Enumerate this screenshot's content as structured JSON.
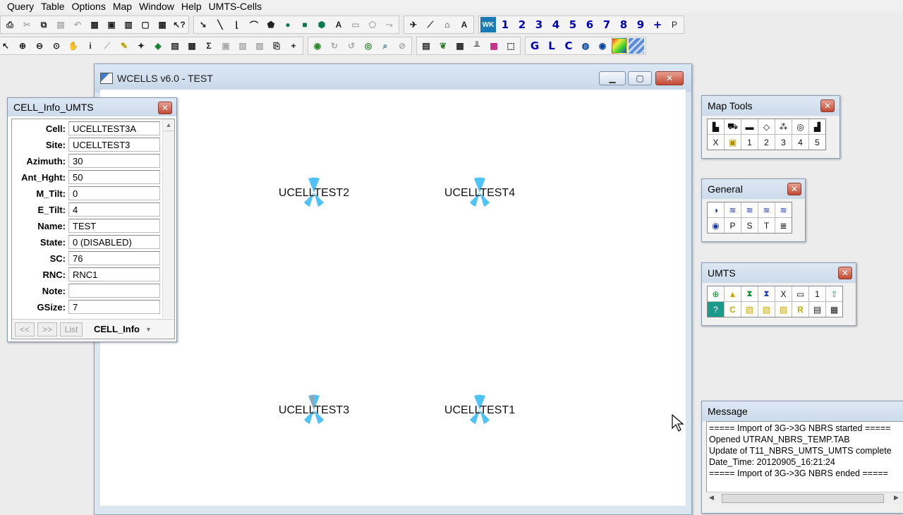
{
  "menu": [
    "Query",
    "Table",
    "Options",
    "Map",
    "Window",
    "Help",
    "UMTS-Cells"
  ],
  "toolbar": {
    "numbers": [
      "1",
      "2",
      "3",
      "4",
      "5",
      "6",
      "7",
      "8",
      "9"
    ],
    "plus": "+",
    "p": "P",
    "letters": [
      "G",
      "L",
      "C"
    ],
    "sigma": "Σ",
    "info": "i",
    "text": "A"
  },
  "main_window": {
    "title": "WCELLS v6.0 - TEST"
  },
  "map": {
    "cells": [
      {
        "name": "UCELLTEST2"
      },
      {
        "name": "UCELLTEST4"
      },
      {
        "name": "UCELLTEST3"
      },
      {
        "name": "UCELLTEST1"
      }
    ],
    "antenna_color": "#4fc3f7"
  },
  "cell_info": {
    "title": "CELL_Info_UMTS",
    "fields": [
      {
        "label": "Cell:",
        "value": "UCELLTEST3A"
      },
      {
        "label": "Site:",
        "value": "UCELLTEST3"
      },
      {
        "label": "Azimuth:",
        "value": "30"
      },
      {
        "label": "Ant_Hght:",
        "value": "50"
      },
      {
        "label": "M_Tilt:",
        "value": "0"
      },
      {
        "label": "E_Tilt:",
        "value": "4"
      },
      {
        "label": "Name:",
        "value": "TEST"
      },
      {
        "label": "State:",
        "value": "0 (DISABLED)"
      },
      {
        "label": "SC:",
        "value": "76"
      },
      {
        "label": "RNC:",
        "value": "RNC1"
      },
      {
        "label": "Note:",
        "value": ""
      },
      {
        "label": "GSize:",
        "value": "7"
      }
    ],
    "nav": {
      "prev": "<<",
      "next": ">>",
      "list": "List",
      "form_name": "CELL_Info"
    }
  },
  "map_tools": {
    "title": "Map Tools",
    "row2": [
      "X",
      "",
      "1",
      "2",
      "3",
      "4",
      "5"
    ]
  },
  "general": {
    "title": "General",
    "row2": [
      "",
      "P",
      "S",
      "T",
      ""
    ]
  },
  "umts": {
    "title": "UMTS",
    "row1": [
      "",
      "",
      "",
      "",
      "X",
      "",
      "1",
      ""
    ],
    "row2": [
      "",
      "C",
      "",
      "",
      "R",
      "",
      "",
      " "
    ]
  },
  "message": {
    "title": "Message",
    "lines": [
      "===== Import of 3G->3G NBRS started =====",
      "Opened UTRAN_NBRS_TEMP.TAB",
      "Update of T11_NBRS_UMTS_UMTS complete",
      "Date_Time: 20120905_16:21:24",
      "===== Import of 3G->3G NBRS ended ====="
    ]
  }
}
